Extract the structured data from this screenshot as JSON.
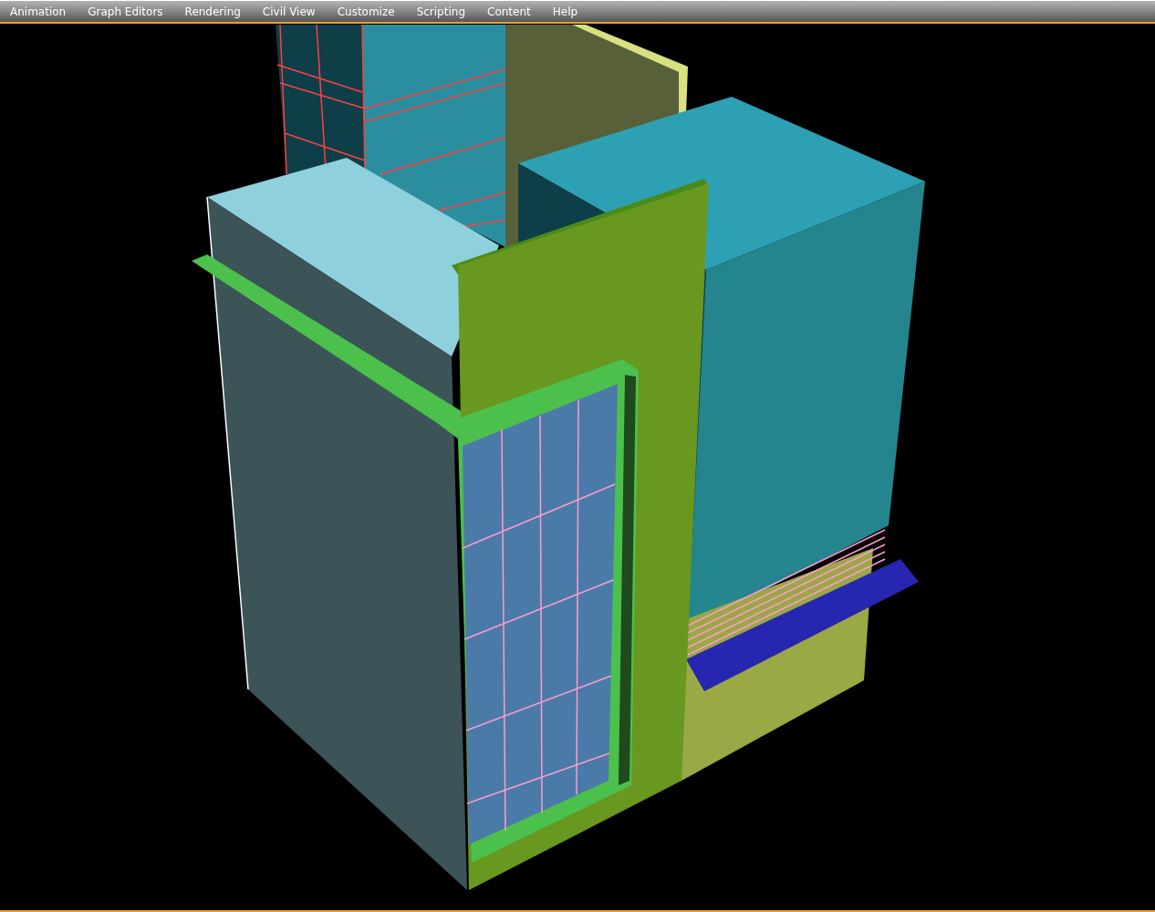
{
  "menu_bar": {
    "items": [
      {
        "label": "Animation"
      },
      {
        "label": "Graph Editors"
      },
      {
        "label": "Rendering"
      },
      {
        "label": "Civil View"
      },
      {
        "label": "Customize"
      },
      {
        "label": "Scripting"
      },
      {
        "label": "Content"
      },
      {
        "label": "Help"
      }
    ]
  },
  "viewport": {
    "active": true
  }
}
